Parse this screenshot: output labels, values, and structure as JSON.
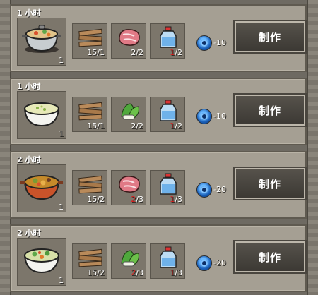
{
  "button_label": "制作",
  "recipes": [
    {
      "time": "1 小时",
      "product": {
        "name": "stew-pot-icon",
        "qty": "1"
      },
      "ingredients": [
        {
          "icon": "wood-planks-icon",
          "have": "15",
          "need": "/1",
          "short": false
        },
        {
          "icon": "raw-meat-icon",
          "have": "2",
          "need": "/2",
          "short": false
        },
        {
          "icon": "water-bottle-icon",
          "have": "1",
          "need": "/2",
          "short": true
        }
      ],
      "energy": "-10"
    },
    {
      "time": "1 小时",
      "product": {
        "name": "soup-bowl-icon",
        "qty": "1"
      },
      "ingredients": [
        {
          "icon": "wood-planks-icon",
          "have": "15",
          "need": "/1",
          "short": false
        },
        {
          "icon": "vegetables-icon",
          "have": "2",
          "need": "/2",
          "short": false
        },
        {
          "icon": "water-bottle-icon",
          "have": "1",
          "need": "/2",
          "short": true
        }
      ],
      "energy": "-10"
    },
    {
      "time": "2 小时",
      "product": {
        "name": "meat-stew-pan-icon",
        "qty": "1"
      },
      "ingredients": [
        {
          "icon": "wood-planks-icon",
          "have": "15",
          "need": "/2",
          "short": false
        },
        {
          "icon": "raw-meat-icon",
          "have": "2",
          "need": "/3",
          "short": true
        },
        {
          "icon": "water-bottle-icon",
          "have": "1",
          "need": "/3",
          "short": true
        }
      ],
      "energy": "-20"
    },
    {
      "time": "2 小时",
      "product": {
        "name": "vegetable-soup-bowl-icon",
        "qty": "1"
      },
      "ingredients": [
        {
          "icon": "wood-planks-icon",
          "have": "15",
          "need": "/2",
          "short": false
        },
        {
          "icon": "vegetables-icon",
          "have": "2",
          "need": "/3",
          "short": true
        },
        {
          "icon": "water-bottle-icon",
          "have": "1",
          "need": "/3",
          "short": true
        }
      ],
      "energy": "-20"
    }
  ]
}
